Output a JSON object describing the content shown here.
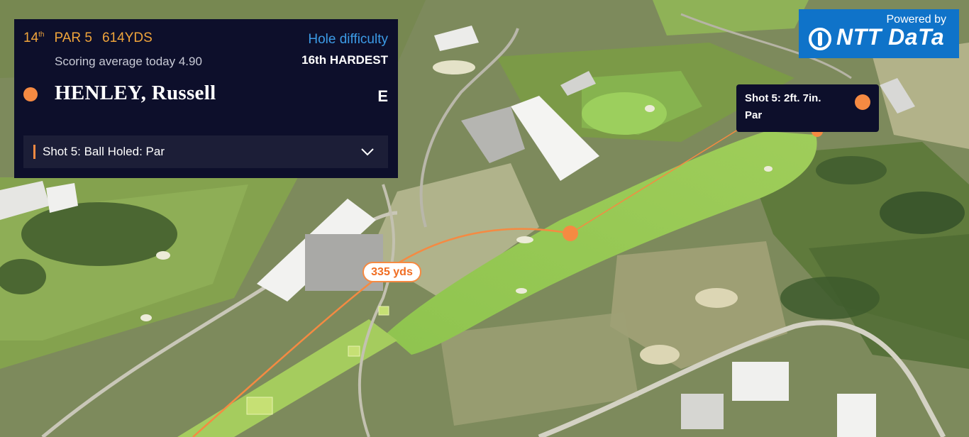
{
  "hole": {
    "number": "14",
    "suffix": "th",
    "par": "PAR 5",
    "yards": "614YDS",
    "scoring": "Scoring average today 4.90",
    "difficulty_label": "Hole difficulty",
    "difficulty_value": "16th HARDEST"
  },
  "player": {
    "name": "HENLEY, Russell",
    "score": "E"
  },
  "shot_select": {
    "label": "Shot 5: Ball Holed: Par",
    "icon": "chevron-down-icon"
  },
  "brand": {
    "powered": "Powered by",
    "name": "NTT DaTa",
    "icon": "ntt-data-logo-icon"
  },
  "shot_tooltip": {
    "line1": "Shot 5: 2ft. 7in.",
    "line2": "Par"
  },
  "distance_label": "335 yds",
  "colors": {
    "accent": "#f58a42",
    "panel": "#0d0f2b",
    "brand": "#0f73c9",
    "difficulty": "#3c9be6",
    "hole_info": "#f0a43b"
  }
}
